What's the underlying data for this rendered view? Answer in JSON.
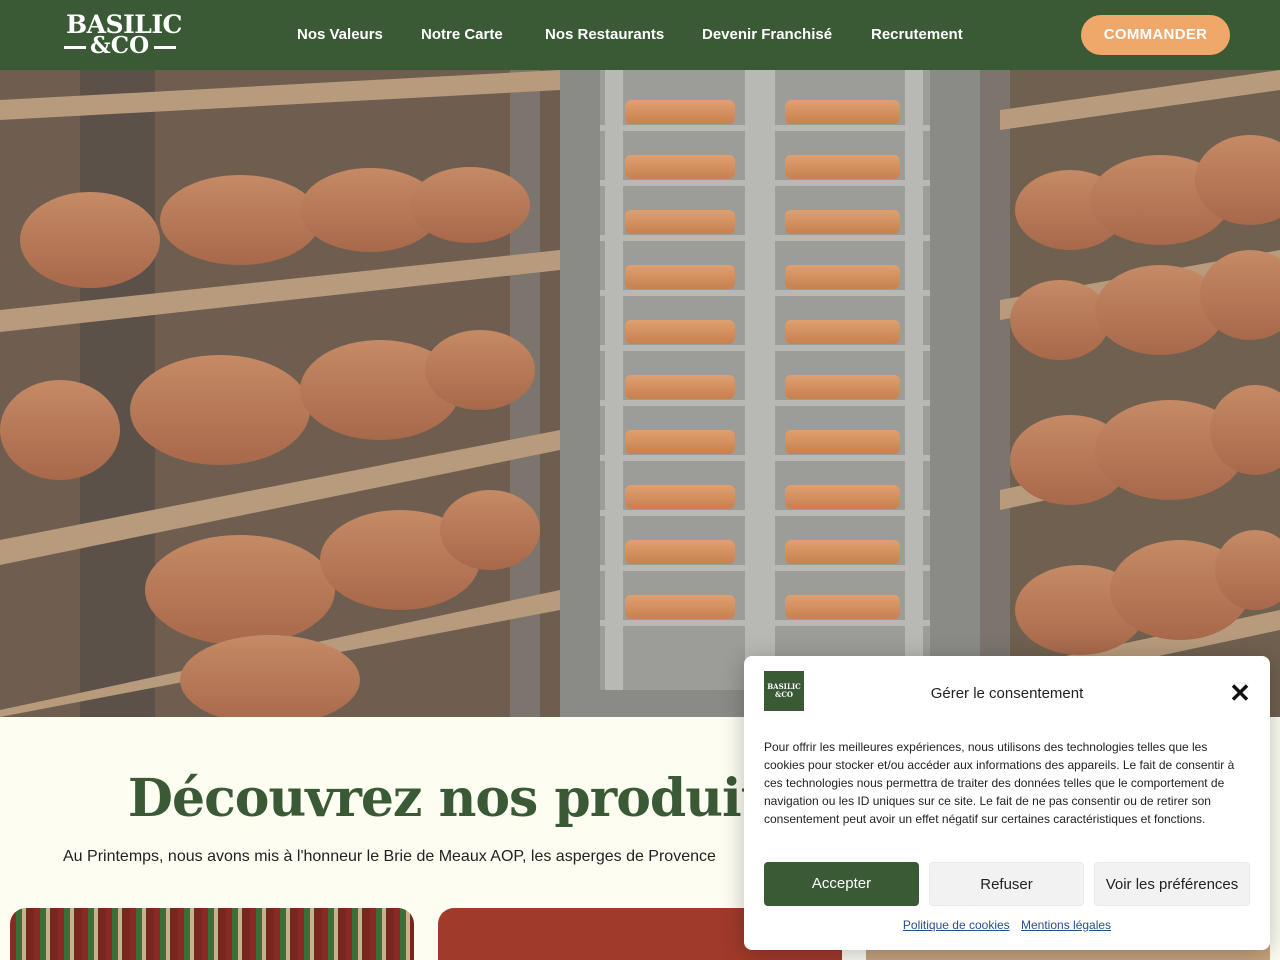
{
  "header": {
    "logo_line1": "BASILIC",
    "logo_line2": "&CO",
    "nav": [
      "Nos Valeurs",
      "Notre Carte",
      "Nos Restaurants",
      "Devenir Franchisé",
      "Recrutement"
    ],
    "cta_label": "COMMANDER"
  },
  "hero": {
    "image_subject": "cheese-cellar"
  },
  "section": {
    "title": "Découvrez nos produits",
    "subtitle": "Au Printemps, nous avons mis à l'honneur le Brie de Meaux AOP, les asperges de Provence"
  },
  "consent": {
    "logo_line1": "BASILIC",
    "logo_line2": "&CO",
    "title": "Gérer le consentement",
    "body": "Pour offrir les meilleures expériences, nous utilisons des technologies telles que les cookies pour stocker et/ou accéder aux informations des appareils. Le fait de consentir à ces technologies nous permettra de traiter des données telles que le comportement de navigation ou les ID uniques sur ce site. Le fait de ne pas consentir ou de retirer son consentement peut avoir un effet négatif sur certaines caractéristiques et fonctions.",
    "accept_label": "Accepter",
    "refuse_label": "Refuser",
    "prefs_label": "Voir les préférences",
    "cookie_policy_label": "Politique de cookies",
    "legal_label": "Mentions légales"
  },
  "colors": {
    "brand_green": "#3a5a36",
    "cta_orange": "#f0a86a",
    "page_bg": "#fdfdf2"
  }
}
